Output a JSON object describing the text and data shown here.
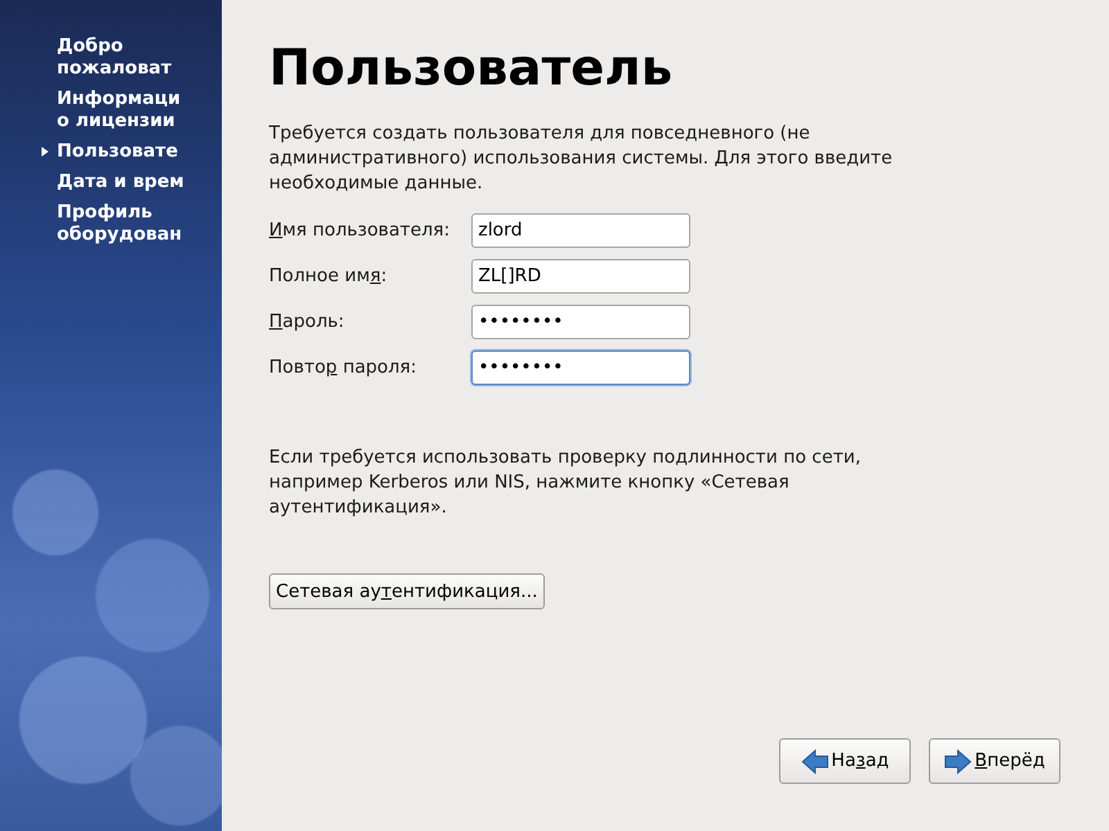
{
  "sidebar": {
    "items": [
      {
        "lines": [
          "Добро",
          "пожаловат"
        ],
        "selected": false
      },
      {
        "lines": [
          "Информаци",
          "о лицензии"
        ],
        "selected": false
      },
      {
        "lines": [
          "Пользовате"
        ],
        "selected": true
      },
      {
        "lines": [
          "Дата и врем"
        ],
        "selected": false
      },
      {
        "lines": [
          "Профиль",
          "оборудован"
        ],
        "selected": false
      }
    ]
  },
  "title": "Пользователь",
  "intro": "Требуется создать пользователя для повседневного (не административного) использования системы. Для этого введите необходимые данные.",
  "fields": [
    {
      "label": {
        "key": "И",
        "post": "мя пользователя:"
      },
      "value": "zlord",
      "focused": false
    },
    {
      "label": {
        "pre": "Полное им",
        "key": "я",
        "post": ":"
      },
      "value": "ZL[]RD",
      "focused": false
    },
    {
      "label": {
        "key": "П",
        "post": "ароль:"
      },
      "value": "••••••••",
      "focused": false
    },
    {
      "label": {
        "pre": "Повто",
        "key": "р",
        "post": " пароля:"
      },
      "value": "••••••••",
      "focused": true
    }
  ],
  "network_note": "Если требуется использовать проверку подлинности по сети, например Kerberos или NIS, нажмите кнопку «Сетевая аутентификация».",
  "network_button": {
    "pre": "Сетевая ау",
    "key": "т",
    "post": "ентификация..."
  },
  "nav_buttons": [
    {
      "kind": "back",
      "label": {
        "pre": "На",
        "key": "з",
        "post": "ад"
      }
    },
    {
      "kind": "forward",
      "label": {
        "key": "В",
        "post": "перёд"
      }
    }
  ]
}
